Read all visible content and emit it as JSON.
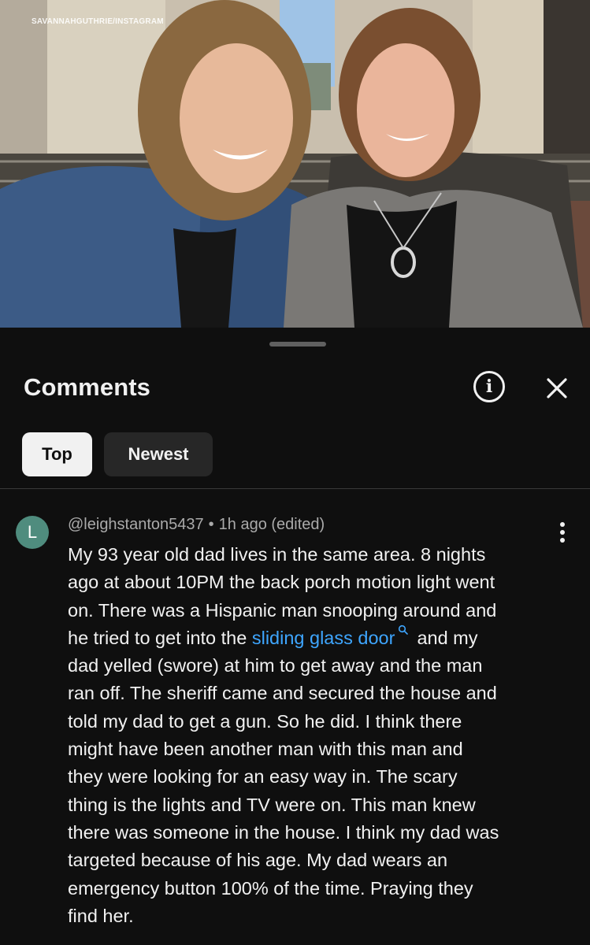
{
  "photo": {
    "watermark": "SAVANNAHGUTHRIE/INSTAGRAM"
  },
  "sheet": {
    "title": "Comments",
    "info_icon": "info-icon",
    "close_icon": "close-icon",
    "tabs": [
      {
        "label": "Top",
        "active": true
      },
      {
        "label": "Newest",
        "active": false
      }
    ]
  },
  "comment": {
    "avatar_letter": "L",
    "author": "@leighstanton5437",
    "time": "1h ago (edited)",
    "lines": [
      "My 93 year old dad lives in the same area. 8 nights",
      "ago at about 10PM the back porch motion light went",
      "on. There was a Hispanic man snooping around and",
      "he tried to get into the",
      "sliding glass door",
      "and my",
      "dad yelled (swore) at him to get away and the man",
      "ran off. The sheriff came and secured the house and",
      "told my dad to get a gun. So he did. I think there",
      "might have been another man with this man and",
      "they were looking for an easy way in. The scary",
      "thing is the lights and TV were on. This man knew",
      "there was someone in the house. I think my dad was",
      "targeted because of his age. My dad wears an",
      "emergency button 100% of the time. Praying they",
      "find her."
    ]
  },
  "colors": {
    "background": "#0f0f0f",
    "link": "#3ea6ff",
    "avatar": "#4f8c7e",
    "chip_active": "#f1f1f1",
    "chip_inactive": "#272727"
  }
}
